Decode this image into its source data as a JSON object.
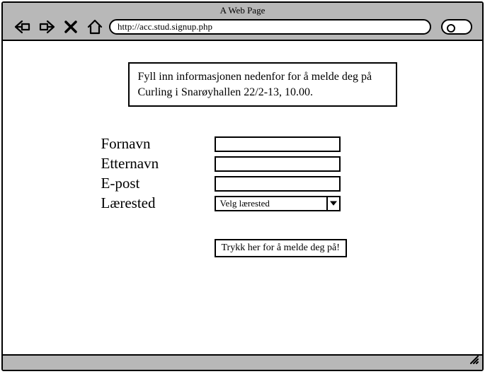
{
  "window": {
    "title": "A Web Page",
    "url": "http://acc.stud.signup.php"
  },
  "instructions": "Fyll inn informasjonen nedenfor for å melde deg på Curling i Snarøyhallen 22/2-13, 10.00.",
  "form": {
    "fornavn": {
      "label": "Fornavn",
      "value": ""
    },
    "etternavn": {
      "label": "Etternavn",
      "value": ""
    },
    "epost": {
      "label": "E-post",
      "value": ""
    },
    "laerested": {
      "label": "Lærested",
      "selected": "Velg lærested"
    },
    "submit_label": "Trykk her for å melde deg på!"
  }
}
